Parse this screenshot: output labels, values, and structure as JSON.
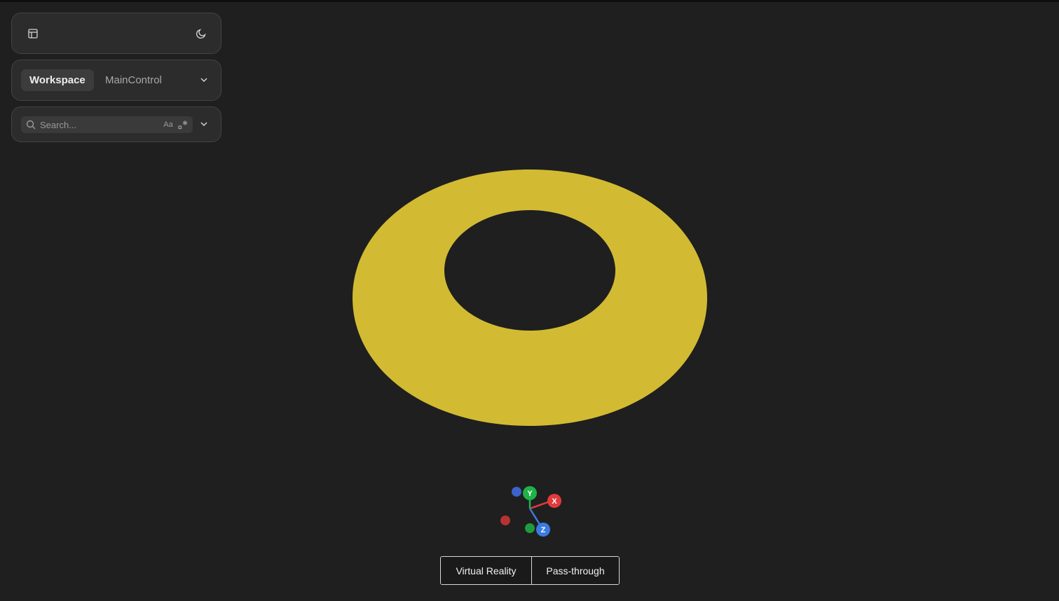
{
  "toolbar": {
    "layout_icon": "layout-panel-icon",
    "theme_icon": "moon-icon"
  },
  "tabs": {
    "items": [
      {
        "label": "Workspace",
        "active": true
      },
      {
        "label": "MainControl",
        "active": false
      }
    ],
    "expand_icon": "chevron-down-icon"
  },
  "search": {
    "placeholder": "Search...",
    "match_case_label": "Aa",
    "regex_icon": "regex-icon",
    "expand_icon": "chevron-down-icon"
  },
  "scene": {
    "object": "torus",
    "object_color": "#d2bb33",
    "background_color": "#1f1f1f"
  },
  "axes_gizmo": {
    "x_label": "X",
    "y_label": "Y",
    "z_label": "Z",
    "x_color": "#e03b3b",
    "y_color": "#1fb24a",
    "z_color": "#3b7ae0"
  },
  "modes": {
    "vr_label": "Virtual Reality",
    "passthrough_label": "Pass-through"
  }
}
